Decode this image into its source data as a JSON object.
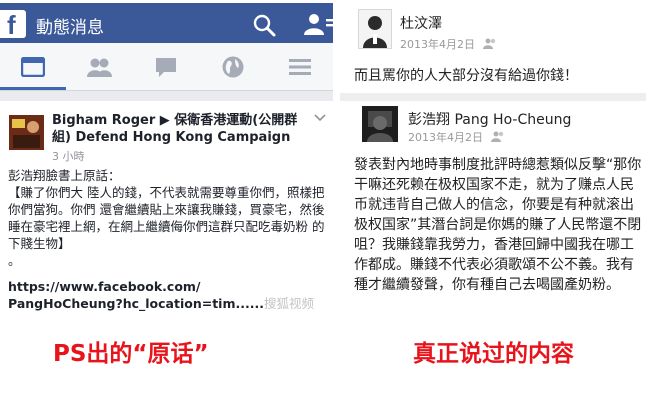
{
  "left": {
    "app_logo": "f",
    "header_title": "動態消息",
    "post": {
      "author": "Bigham Roger ▶ 保衛香港運動(公開群組) Defend Hong Kong Campaign",
      "time": "3 小時",
      "lines": [
        "彭浩翔臉書上原話：",
        "【賺了你們大 陸人的錢，不代表就需要尊重你們，照樣把你們當狗。你們 還會繼續貼上來讓我賺錢，買豪宅，然後睡在豪宅裡上網，在網上繼續侮你們這群只配吃毒奶粉 的下賤生物】",
        "。"
      ],
      "link_line_1": "https://www.facebook.com/",
      "link_line_2": "PangHoCheung?hc_location=tim......",
      "watermark": "搜狐视频"
    },
    "icons": [
      "facebook-logo",
      "search-icon",
      "people-icon",
      "news-feed-icon",
      "friends-icon",
      "messages-icon",
      "globe-icon",
      "menu-icon"
    ]
  },
  "right": {
    "post1": {
      "name": "杜汶澤",
      "time": "2013年4月2日",
      "body": "而且罵你的人大部分沒有給過你錢！"
    },
    "post2": {
      "name": "彭浩翔 Pang Ho-Cheung",
      "time": "2013年4月2日",
      "body": "發表對內地時事制度批評時總惹類似反擊“那你干嘛还死赖在极权国家不走，就为了赚点人民币就违背自己做人的信念，你要是有种就滚出极权国家”其潛台詞是你媽的賺了人民幣還不閉咀？我賺錢靠我勞力，香港回歸中國我在哪工作都成。賺錢不代表必須歌頌不公不義。我有種才繼續發聲，你有種自己去喝國產奶粉。"
    }
  },
  "captions": {
    "left": "PS出的“原话”",
    "right": "真正说过的内容"
  },
  "colors": {
    "facebook_blue": "#3b5998",
    "caption_red": "#e8141b"
  }
}
